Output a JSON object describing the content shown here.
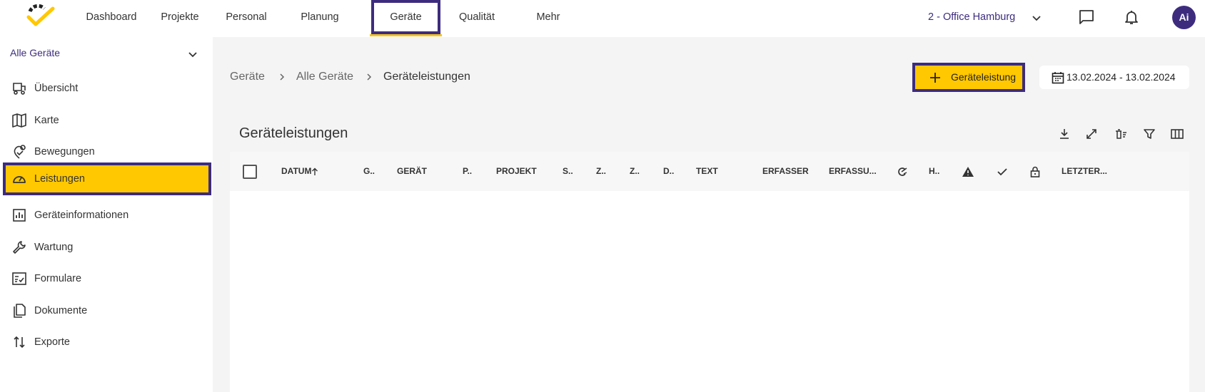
{
  "nav": {
    "items": [
      {
        "label": "Dashboard"
      },
      {
        "label": "Projekte"
      },
      {
        "label": "Personal"
      },
      {
        "label": "Planung"
      },
      {
        "label": "Geräte"
      },
      {
        "label": "Qualität"
      },
      {
        "label": "Mehr"
      }
    ],
    "office": "2 - Office Hamburg",
    "avatar": "Ai"
  },
  "sidebar": {
    "header": "Alle Geräte",
    "items": [
      {
        "label": "Übersicht",
        "icon": "forklift-icon"
      },
      {
        "label": "Karte",
        "icon": "map-icon"
      },
      {
        "label": "Bewegungen",
        "icon": "route-icon"
      },
      {
        "label": "Leistungen",
        "icon": "gauge-icon"
      },
      {
        "label": "Geräteinformationen",
        "icon": "chart-box-icon"
      },
      {
        "label": "Wartung",
        "icon": "wrench-icon"
      },
      {
        "label": "Formulare",
        "icon": "form-checklist-icon"
      },
      {
        "label": "Dokumente",
        "icon": "documents-icon"
      },
      {
        "label": "Exporte",
        "icon": "swap-arrows-icon"
      }
    ]
  },
  "breadcrumb": {
    "items": [
      "Geräte",
      "Alle Geräte",
      "Geräteleistungen"
    ]
  },
  "actions": {
    "add_label": "Geräteleistung",
    "date_range": "13.02.2024 - 13.02.2024"
  },
  "table": {
    "title": "Geräteleistungen",
    "columns": {
      "datum": "DATUM",
      "g": "G..",
      "geraet": "GERÄT",
      "p": "P..",
      "projekt": "PROJEKT",
      "s": "S..",
      "z1": "Z..",
      "z2": "Z..",
      "d": "D..",
      "text": "TEXT",
      "erfasser": "ERFASSER",
      "erfassu": "ERFASSU...",
      "h": "H..",
      "letzter": "LETZTER..."
    }
  },
  "colors": {
    "accent": "#ffc800",
    "brand": "#3d2c7e"
  }
}
